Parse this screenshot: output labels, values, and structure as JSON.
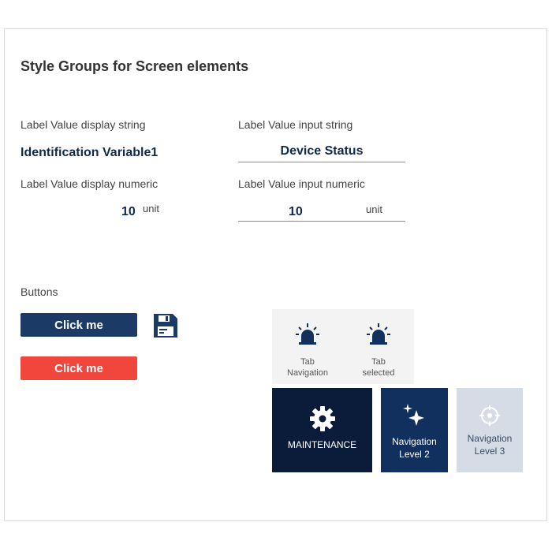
{
  "page": {
    "title": "Style Groups for Screen elements"
  },
  "display_string": {
    "label": "Label Value display string",
    "value": "Identification Variable1"
  },
  "input_string": {
    "label": "Label Value input string",
    "value": "Device Status"
  },
  "display_numeric": {
    "label": "Label Value display numeric",
    "value": "10",
    "unit": "unit"
  },
  "input_numeric": {
    "label": "Label Value input numeric",
    "value": "10",
    "unit": "unit"
  },
  "buttons": {
    "section_label": "Buttons",
    "primary_label": "Click me",
    "danger_label": "Click me",
    "save_icon": "floppy-disk-icon"
  },
  "tabs": [
    {
      "line1": "Tab",
      "line2": "Navigation",
      "icon": "siren-icon"
    },
    {
      "line1": "Tab",
      "line2": "selected",
      "icon": "siren-icon"
    }
  ],
  "navigation": {
    "level1": {
      "label": "MAINTENANCE",
      "icon": "gear-icon"
    },
    "level2": {
      "line1": "Navigation",
      "line2": "Level 2",
      "icon": "sparkles-icon"
    },
    "level3": {
      "line1": "Navigation",
      "line2": "Level 3",
      "icon": "crosshair-icon"
    }
  },
  "colors": {
    "primary": "#1c3a66",
    "danger": "#f0463c",
    "nav_level1": "#0b1c3a",
    "nav_level2": "#12305d",
    "nav_level3": "#d5dce6",
    "tab_bar": "#f3f3f3",
    "value_text": "#0f2a4d"
  }
}
